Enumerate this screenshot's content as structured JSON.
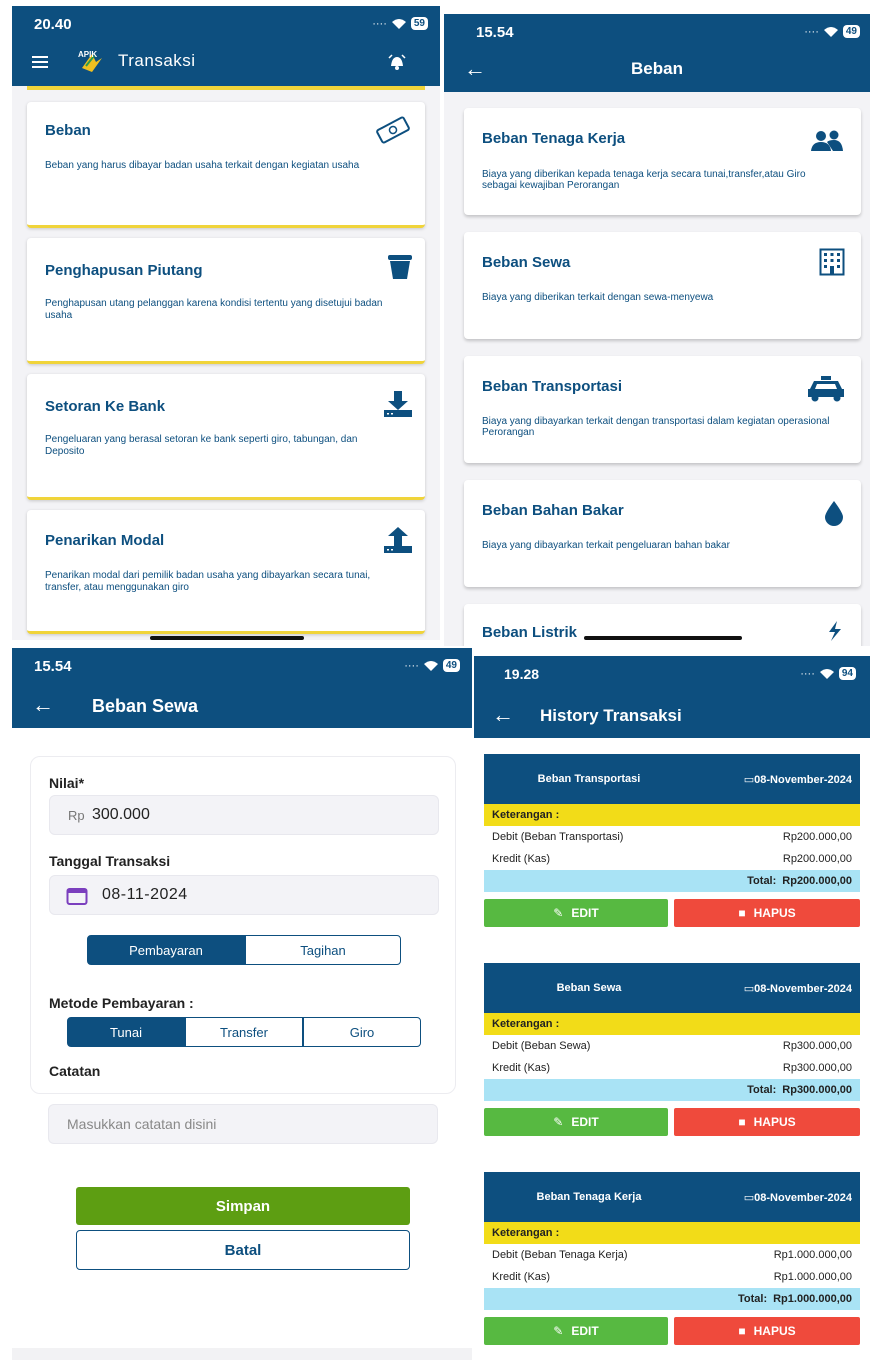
{
  "p1": {
    "status": {
      "time": "20.40",
      "battery": "59"
    },
    "title": "Transaksi",
    "logo": "APIK",
    "cards": [
      {
        "title": "Beban",
        "desc": "Beban yang harus dibayar badan usaha terkait dengan kegiatan usaha",
        "icon": "money-icon"
      },
      {
        "title": "Penghapusan Piutang",
        "desc": "Penghapusan utang pelanggan karena kondisi tertentu yang disetujui badan usaha",
        "icon": "trash-icon"
      },
      {
        "title": "Setoran Ke Bank",
        "desc": "Pengeluaran yang berasal setoran ke bank seperti giro, tabungan, dan Deposito",
        "icon": "download-icon"
      },
      {
        "title": "Penarikan Modal",
        "desc": "Penarikan modal dari pemilik badan usaha yang dibayarkan secara tunai, transfer, atau menggunakan giro",
        "icon": "upload-icon"
      }
    ]
  },
  "p2": {
    "status": {
      "time": "15.54",
      "battery": "49"
    },
    "title": "Beban",
    "cards": [
      {
        "title": "Beban Tenaga Kerja",
        "desc": "Biaya yang diberikan kepada tenaga kerja secara tunai,transfer,atau Giro sebagai kewajiban Perorangan",
        "icon": "people-icon"
      },
      {
        "title": "Beban Sewa",
        "desc": "Biaya yang diberikan terkait dengan sewa-menyewa",
        "icon": "building-icon"
      },
      {
        "title": "Beban Transportasi",
        "desc": "Biaya yang dibayarkan terkait dengan transportasi dalam kegiatan operasional Perorangan",
        "icon": "taxi-icon"
      },
      {
        "title": "Beban Bahan Bakar",
        "desc": "Biaya yang dibayarkan terkait pengeluaran bahan bakar",
        "icon": "drop-icon"
      },
      {
        "title": "Beban Listrik",
        "desc": "",
        "icon": "bolt-icon"
      }
    ]
  },
  "p3": {
    "status": {
      "time": "15.54",
      "battery": "49"
    },
    "title": "Beban Sewa",
    "nilai_label": "Nilai*",
    "nilai_prefix": "Rp",
    "nilai_value": "300.000",
    "tanggal_label": "Tanggal Transaksi",
    "tanggal_value": "08-11-2024",
    "type_options": [
      "Pembayaran",
      "Tagihan"
    ],
    "metode_label": "Metode Pembayaran :",
    "metode_options": [
      "Tunai",
      "Transfer",
      "Giro"
    ],
    "catatan_label": "Catatan",
    "catatan_placeholder": "Masukkan catatan disini",
    "simpan": "Simpan",
    "batal": "Batal"
  },
  "p4": {
    "status": {
      "time": "19.28",
      "battery": "94"
    },
    "title": "History Transaksi",
    "ket_label": "Keterangan :",
    "total_label": "Total:",
    "edit_label": "EDIT",
    "hapus_label": "HAPUS",
    "items": [
      {
        "name": "Beban Transportasi",
        "date": "08-November-2024",
        "debit_label": "Debit (Beban Transportasi)",
        "debit": "Rp200.000,00",
        "kredit_label": "Kredit (Kas)",
        "kredit": "Rp200.000,00",
        "total": "Rp200.000,00"
      },
      {
        "name": "Beban Sewa",
        "date": "08-November-2024",
        "debit_label": "Debit (Beban Sewa)",
        "debit": "Rp300.000,00",
        "kredit_label": "Kredit (Kas)",
        "kredit": "Rp300.000,00",
        "total": "Rp300.000,00"
      },
      {
        "name": "Beban Tenaga Kerja",
        "date": "08-November-2024",
        "debit_label": "Debit (Beban Tenaga Kerja)",
        "debit": "Rp1.000.000,00",
        "kredit_label": "Kredit (Kas)",
        "kredit": "Rp1.000.000,00",
        "total": "Rp1.000.000,00"
      }
    ]
  },
  "colors": {
    "primary": "#0d4f7f",
    "accent_yellow": "#f2dc18",
    "save_green": "#5d9e12",
    "edit_green": "#57b941",
    "delete_red": "#ef4a3c",
    "total_blue": "#a9e3f5"
  }
}
